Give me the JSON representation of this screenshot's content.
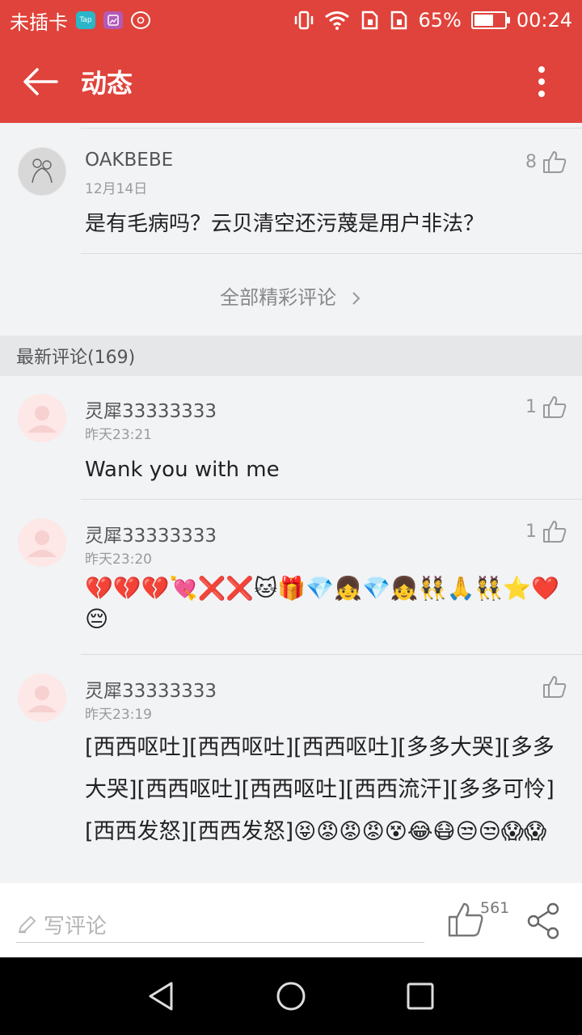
{
  "status_bar": {
    "carrier": "未插卡",
    "app_icons": [
      "taptap-icon",
      "gallery-icon",
      "netease-music-icon"
    ],
    "battery": "65%",
    "battery_level": 0.65,
    "time": "00:24"
  },
  "header": {
    "title": "动态"
  },
  "hot_comment": {
    "username": "OAKBEBE",
    "date": "12月14日",
    "likes": "8",
    "text": "是有毛病吗？云贝清空还污蔑是用户非法？"
  },
  "all_hot_label": "全部精彩评论",
  "latest": {
    "header": "最新评论(169)",
    "comments": [
      {
        "username": "灵犀33333333",
        "date": "昨天23:21",
        "likes": "1",
        "text": "Wank you with me"
      },
      {
        "username": "灵犀33333333",
        "date": "昨天23:20",
        "likes": "1",
        "text": "💔💔💔💘❌❌🐱🎁💎👧💎👧👯🙏👯⭐❤️😔"
      },
      {
        "username": "灵犀33333333",
        "date": "昨天23:19",
        "likes": "",
        "text": "[西西呕吐][西西呕吐][西西呕吐][多多大哭][多多大哭][西西呕吐][西西呕吐][西西流汗][多多可怜][西西发怒][西西发怒]😝😡😡😡😵😂😷😒😒😱😱"
      }
    ]
  },
  "bottom_bar": {
    "placeholder": "写评论",
    "like_count": "561"
  }
}
